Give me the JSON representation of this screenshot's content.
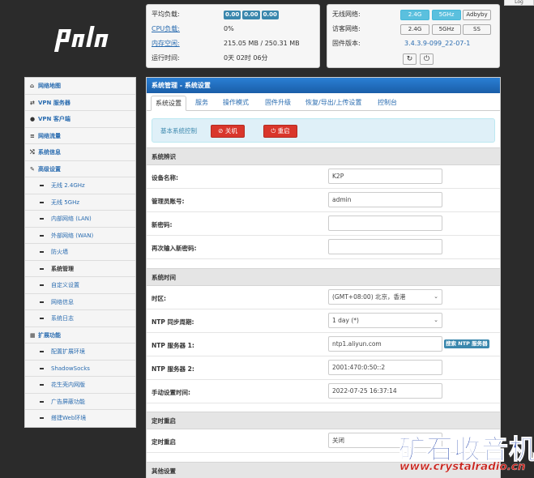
{
  "logo_text": "padavan",
  "login_tab": "Log",
  "status_left": {
    "load_label": "平均负载:",
    "load_values": [
      "0.00",
      "0.00",
      "0.00"
    ],
    "cpu_label": "CPU负载:",
    "cpu_value": "0%",
    "mem_label": "内存空闲:",
    "mem_value": "215.05 MB / 250.31 MB",
    "uptime_label": "运行时间:",
    "uptime_value": "0天 02时 06分"
  },
  "status_right": {
    "wireless_label": "无线网络:",
    "wireless_btns": [
      "2.4G",
      "5GHz",
      "Adbyby"
    ],
    "guest_label": "访客网络:",
    "guest_btns": [
      "2.4G",
      "5GHz",
      "SS"
    ],
    "firmware_label": "固件版本:",
    "firmware_value": "3.4.3.9-099_22-07-1",
    "refresh_icon": "↻",
    "power_icon": "⏻"
  },
  "sidebar": {
    "items": [
      {
        "label": "网络地图",
        "icon": "⌂"
      },
      {
        "label": "VPN 服务器",
        "icon": "⇄"
      },
      {
        "label": "VPN 客户端",
        "icon": "●"
      },
      {
        "label": "网络流量",
        "icon": "≡"
      },
      {
        "label": "系统信息",
        "icon": "⤭"
      },
      {
        "label": "高级设置",
        "icon": "✎"
      },
      {
        "label": "无线 2.4GHz"
      },
      {
        "label": "无线 5GHz"
      },
      {
        "label": "内部网络 (LAN)"
      },
      {
        "label": "外部网络 (WAN)"
      },
      {
        "label": "防火墙"
      },
      {
        "label": "系统管理"
      },
      {
        "label": "自定义设置"
      },
      {
        "label": "网络信息"
      },
      {
        "label": "系统日志"
      },
      {
        "label": "扩展功能",
        "icon": "▦"
      },
      {
        "label": "配置扩展环境"
      },
      {
        "label": "ShadowSocks"
      },
      {
        "label": "花生壳内网版"
      },
      {
        "label": "广告屏蔽功能"
      },
      {
        "label": "搭建Web环境"
      }
    ]
  },
  "main": {
    "title": "系统管理 - 系统设置",
    "tabs": [
      "系统设置",
      "服务",
      "操作模式",
      "固件升级",
      "恢复/导出/上传设置",
      "控制台"
    ],
    "alert_label": "基本系统控制",
    "shutdown_label": "⊘ 关机",
    "reboot_label": "⏻ 重启",
    "sections": {
      "identity": "系统辨识",
      "time": "系统时间",
      "reboot": "定时重启",
      "other": "其他设置"
    },
    "fields": {
      "device_name_label": "设备名称:",
      "device_name_value": "K2P",
      "admin_label": "管理员账号:",
      "admin_value": "admin",
      "new_pw_label": "新密码:",
      "new_pw_value": "",
      "re_pw_label": "再次输入新密码:",
      "re_pw_value": "",
      "tz_label": "时区:",
      "tz_value": "(GMT+08:00) 北京，香港",
      "ntp_period_label": "NTP 同步周期:",
      "ntp_period_value": "1 day (*)",
      "ntp1_label": "NTP 服务器 1:",
      "ntp1_value": "ntp1.aliyun.com",
      "ntp_link": "搜索 NTP 服务器",
      "ntp2_label": "NTP 服务器 2:",
      "ntp2_value": "2001:470:0:50::2",
      "manual_time_label": "手动设置时间:",
      "manual_time_value": "2022-07-25 16:37:14",
      "reboot_label": "定时重启",
      "reboot_value": "关闭"
    }
  },
  "watermark": {
    "cn": "矿石收音机",
    "url": "www.crystalradio.cn"
  },
  "colors": {
    "accent": "#2a6cb0",
    "header_blue": "#1a5ea8",
    "badge": "#3a87ad",
    "danger": "#d9362b",
    "wm_blue": "#1b3ea8",
    "wm_red": "#c8231c"
  }
}
